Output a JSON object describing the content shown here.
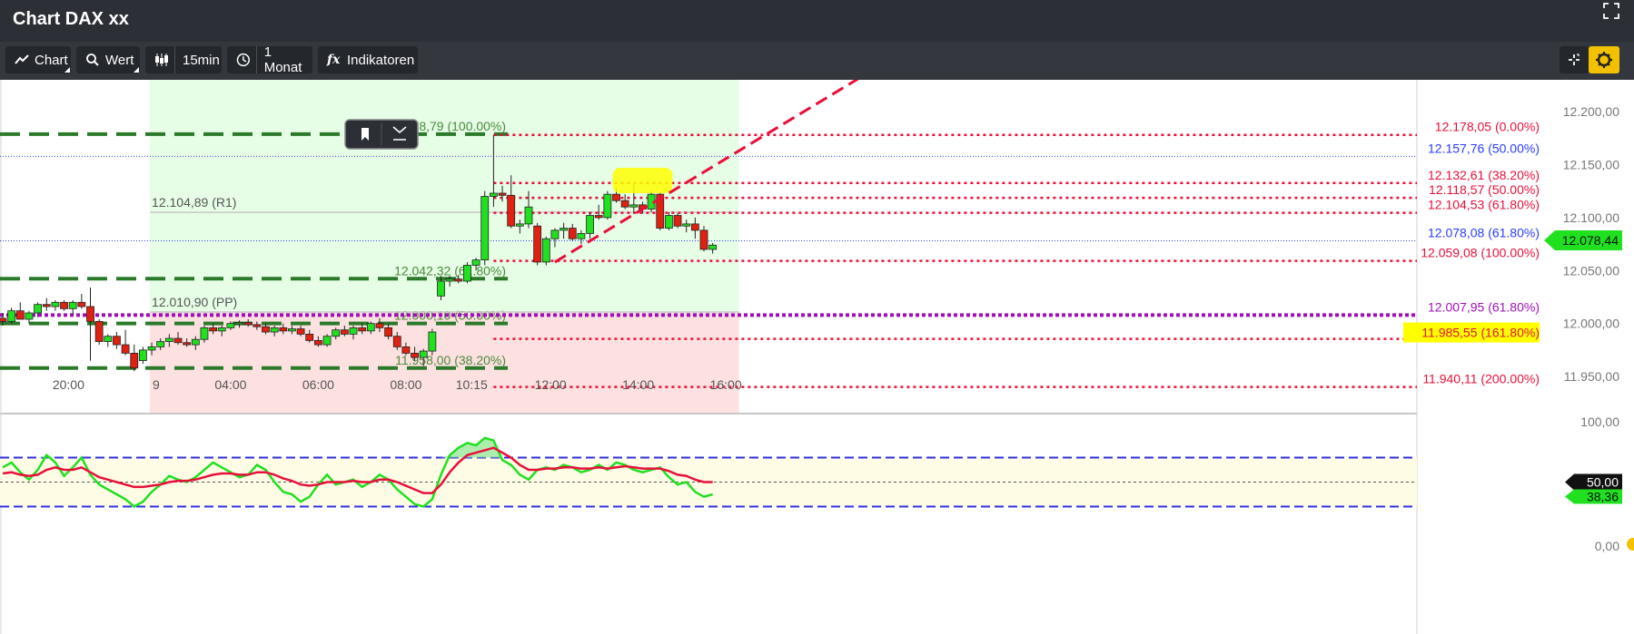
{
  "window": {
    "title": "Chart DAX xx"
  },
  "toolbar": {
    "chart_label": "Chart",
    "wert_label": "Wert",
    "interval_label": "15min",
    "period_label": "1 Monat",
    "indicators_label": "Indikatoren"
  },
  "colors": {
    "up": "#20e020",
    "down": "#e02010",
    "fib_red": "#e8103a",
    "blue": "#2a3cff",
    "green_dash": "#2a7a2a",
    "purple": "#a010b8",
    "yellow": "#ffff00",
    "rsi_green": "#20e020",
    "rsi_red": "#e8103a"
  },
  "chart_data": {
    "type": "candlestick",
    "price_axis": {
      "ylim": [
        11915,
        12230
      ],
      "ticks": [
        {
          "value": 12200,
          "label": "12.200,00"
        },
        {
          "value": 12150,
          "label": "12.150,00"
        },
        {
          "value": 12100,
          "label": "12.100,00"
        },
        {
          "value": 12050,
          "label": "12.050,00"
        },
        {
          "value": 12000,
          "label": "12.000,00"
        },
        {
          "value": 11950,
          "label": "11.950,00"
        }
      ]
    },
    "time_axis": {
      "ticks": [
        {
          "label": "20:00",
          "bar": 7.5
        },
        {
          "label": "9",
          "bar": 17.5
        },
        {
          "label": "04:00",
          "bar": 26
        },
        {
          "label": "06:00",
          "bar": 36
        },
        {
          "label": "08:00",
          "bar": 46
        },
        {
          "label": "10:15",
          "bar": 53.5
        },
        {
          "label": "12:00",
          "bar": 62.5
        },
        {
          "label": "14:00",
          "bar": 72.5
        },
        {
          "label": "16:00",
          "bar": 82.5
        }
      ]
    },
    "candles": [
      [
        12005,
        12010,
        11998,
        12002
      ],
      [
        12002,
        12015,
        12000,
        12012
      ],
      [
        12012,
        12020,
        12008,
        12004
      ],
      [
        12004,
        12012,
        12000,
        12010
      ],
      [
        12010,
        12020,
        12006,
        12018
      ],
      [
        12018,
        12024,
        12012,
        12016
      ],
      [
        12016,
        12022,
        12012,
        12020
      ],
      [
        12020,
        12022,
        12012,
        12014
      ],
      [
        12014,
        12022,
        12008,
        12020
      ],
      [
        12020,
        12028,
        12014,
        12016
      ],
      [
        12016,
        12034,
        11965,
        12002
      ],
      [
        12002,
        12004,
        11980,
        11983
      ],
      [
        11983,
        11990,
        11978,
        11988
      ],
      [
        11988,
        11992,
        11976,
        11980
      ],
      [
        11980,
        11994,
        11970,
        11972
      ],
      [
        11972,
        11980,
        11955,
        11958
      ],
      [
        11965,
        11978,
        11962,
        11975
      ],
      [
        11975,
        11982,
        11970,
        11978
      ],
      [
        11978,
        11986,
        11975,
        11983
      ],
      [
        11983,
        11990,
        11978,
        11986
      ],
      [
        11986,
        11992,
        11980,
        11982
      ],
      [
        11982,
        11986,
        11978,
        11980
      ],
      [
        11980,
        11988,
        11975,
        11985
      ],
      [
        11985,
        11998,
        11982,
        11996
      ],
      [
        11996,
        12000,
        11990,
        11993
      ],
      [
        11993,
        11998,
        11988,
        11996
      ],
      [
        11996,
        12002,
        11994,
        12000
      ],
      [
        12000,
        12003,
        11996,
        12001
      ],
      [
        12001,
        12004,
        11997,
        11999
      ],
      [
        11999,
        12002,
        11994,
        11997
      ],
      [
        11997,
        12000,
        11990,
        11992
      ],
      [
        11992,
        11998,
        11988,
        11996
      ],
      [
        11996,
        12000,
        11990,
        11993
      ],
      [
        11993,
        11998,
        11990,
        11995
      ],
      [
        11995,
        11998,
        11988,
        11990
      ],
      [
        11990,
        11994,
        11982,
        11984
      ],
      [
        11984,
        11988,
        11978,
        11980
      ],
      [
        11980,
        11990,
        11978,
        11988
      ],
      [
        11988,
        11996,
        11985,
        11994
      ],
      [
        11994,
        11998,
        11988,
        11990
      ],
      [
        11990,
        11998,
        11985,
        11996
      ],
      [
        11996,
        12000,
        11990,
        11993
      ],
      [
        11993,
        12002,
        11990,
        12000
      ],
      [
        12000,
        12005,
        11992,
        11996
      ],
      [
        11996,
        12000,
        11985,
        11988
      ],
      [
        11988,
        11992,
        11975,
        11978
      ],
      [
        11978,
        11982,
        11970,
        11972
      ],
      [
        11972,
        11978,
        11965,
        11968
      ],
      [
        11968,
        11976,
        11960,
        11974
      ],
      [
        11974,
        11995,
        11970,
        11992
      ],
      [
        12026,
        12045,
        12022,
        12040
      ],
      [
        12040,
        12045,
        12035,
        12042
      ],
      [
        12042,
        12046,
        12038,
        12040
      ],
      [
        12040,
        12058,
        12038,
        12055
      ],
      [
        12055,
        12062,
        12050,
        12060
      ],
      [
        12060,
        12125,
        12055,
        12120
      ],
      [
        12120,
        12178,
        12110,
        12123
      ],
      [
        12123,
        12130,
        12115,
        12121
      ],
      [
        12121,
        12140,
        12090,
        12092
      ],
      [
        12092,
        12098,
        12085,
        12094
      ],
      [
        12094,
        12125,
        12090,
        12110
      ],
      [
        12092,
        12095,
        12055,
        12058
      ],
      [
        12058,
        12082,
        12055,
        12080
      ],
      [
        12080,
        12090,
        12072,
        12088
      ],
      [
        12088,
        12095,
        12080,
        12090
      ],
      [
        12090,
        12094,
        12078,
        12080
      ],
      [
        12080,
        12088,
        12075,
        12085
      ],
      [
        12085,
        12105,
        12080,
        12102
      ],
      [
        12102,
        12112,
        12098,
        12100
      ],
      [
        12100,
        12125,
        12098,
        12122
      ],
      [
        12122,
        12128,
        12114,
        12116
      ],
      [
        12116,
        12122,
        12108,
        12110
      ],
      [
        12110,
        12132,
        12104,
        12112
      ],
      [
        12112,
        12115,
        12104,
        12108
      ],
      [
        12108,
        12125,
        12105,
        12122
      ],
      [
        12122,
        12124,
        12088,
        12090
      ],
      [
        12090,
        12105,
        12088,
        12102
      ],
      [
        12102,
        12104,
        12090,
        12092
      ],
      [
        12092,
        12098,
        12086,
        12094
      ],
      [
        12094,
        12100,
        12080,
        12088
      ],
      [
        12088,
        12092,
        12068,
        12070
      ],
      [
        12070,
        12076,
        12066,
        12074
      ]
    ],
    "levels": [
      {
        "value": 12178.79,
        "label": "12.178,79 (100.00%)",
        "style": "green_dash",
        "from": "left",
        "to": 57,
        "label_side": "left-box"
      },
      {
        "value": 12042.32,
        "label": "12.042,32 (61.80%)",
        "style": "green_dash",
        "from": "left",
        "to": 57,
        "label_side": "left-box"
      },
      {
        "value": 12000.1,
        "label": "12.000,10 (50.00%)",
        "style": "green_dash",
        "from": "left",
        "to": 57,
        "label_side": "left-box"
      },
      {
        "value": 11958.0,
        "label": "11.958,00 (38.20%)",
        "style": "green_dash",
        "from": "left",
        "to": 57,
        "label_side": "left-box"
      },
      {
        "value": 12104.89,
        "label": "12.104,89 (R1)",
        "style": "gray_solid",
        "label_side": "box-left"
      },
      {
        "value": 12010.9,
        "label": "12.010,90 (PP)",
        "style": "gray_solid",
        "label_side": "box-left"
      },
      {
        "value": 12178.05,
        "label": "12.178,05 (0.00%)",
        "style": "fib_red"
      },
      {
        "value": 12132.61,
        "label": "12.132,61 (38.20%)",
        "style": "fib_red"
      },
      {
        "value": 12118.57,
        "label": "12.118,57 (50.00%)",
        "style": "fib_red"
      },
      {
        "value": 12104.53,
        "label": "12.104,53 (61.80%)",
        "style": "fib_red"
      },
      {
        "value": 12059.08,
        "label": "12.059,08 (100.00%)",
        "style": "fib_red"
      },
      {
        "value": 11985.55,
        "label": "11.985,55 (161.80%)",
        "style": "fib_red",
        "highlight": true
      },
      {
        "value": 11940.11,
        "label": "11.940,11 (200.00%)",
        "style": "fib_red"
      },
      {
        "value": 12157.76,
        "label": "12.157,76 (50.00%)",
        "style": "blue"
      },
      {
        "value": 12078.08,
        "label": "12.078,08 (61.80%)",
        "style": "blue"
      },
      {
        "value": 12007.95,
        "label": "12.007,95 (61.80%)",
        "style": "purple"
      }
    ],
    "last_price": {
      "value": 12078.44,
      "label": "12.078,44"
    },
    "rsi": {
      "ylim": [
        0,
        100
      ],
      "ticks": [
        {
          "value": 100,
          "label": "100,00"
        },
        {
          "value": 0,
          "label": "0,00"
        }
      ],
      "upper_band": 70,
      "lower_band": 30,
      "mid": 50,
      "mid_label": "50,00",
      "last_label": "38,36",
      "line": [
        62,
        66,
        58,
        52,
        60,
        72,
        66,
        55,
        62,
        70,
        56,
        48,
        44,
        40,
        36,
        30,
        34,
        42,
        48,
        55,
        52,
        50,
        54,
        60,
        66,
        62,
        58,
        54,
        56,
        64,
        60,
        50,
        42,
        40,
        34,
        38,
        48,
        56,
        48,
        50,
        52,
        46,
        50,
        56,
        52,
        44,
        38,
        32,
        30,
        36,
        56,
        72,
        78,
        82,
        80,
        86,
        84,
        68,
        64,
        56,
        52,
        60,
        62,
        60,
        64,
        62,
        58,
        60,
        64,
        60,
        66,
        64,
        60,
        58,
        60,
        62,
        54,
        48,
        50,
        42,
        38,
        40
      ],
      "signal": [
        57,
        58,
        56,
        55,
        56,
        60,
        62,
        60,
        60,
        62,
        58,
        54,
        52,
        50,
        48,
        46,
        46,
        47,
        48,
        50,
        51,
        51,
        52,
        54,
        56,
        57,
        57,
        56,
        56,
        58,
        58,
        56,
        53,
        51,
        48,
        47,
        48,
        50,
        50,
        50,
        51,
        50,
        50,
        52,
        52,
        50,
        47,
        44,
        41,
        41,
        48,
        58,
        66,
        72,
        74,
        76,
        78,
        74,
        70,
        64,
        60,
        60,
        61,
        61,
        62,
        62,
        61,
        61,
        62,
        61,
        62,
        63,
        62,
        61,
        61,
        61,
        59,
        56,
        55,
        52,
        50,
        50
      ]
    },
    "fib_zone": {
      "from_bar": 17,
      "to_bar": 84,
      "split": 12010.9
    },
    "trendline": {
      "from_bar": 63,
      "from_value": 12058,
      "to_bar": 98,
      "to_value": 12233
    },
    "highlight_blob": {
      "bar_from": 70,
      "bar_to": 76,
      "value_low": 12123,
      "value_high": 12147
    }
  }
}
